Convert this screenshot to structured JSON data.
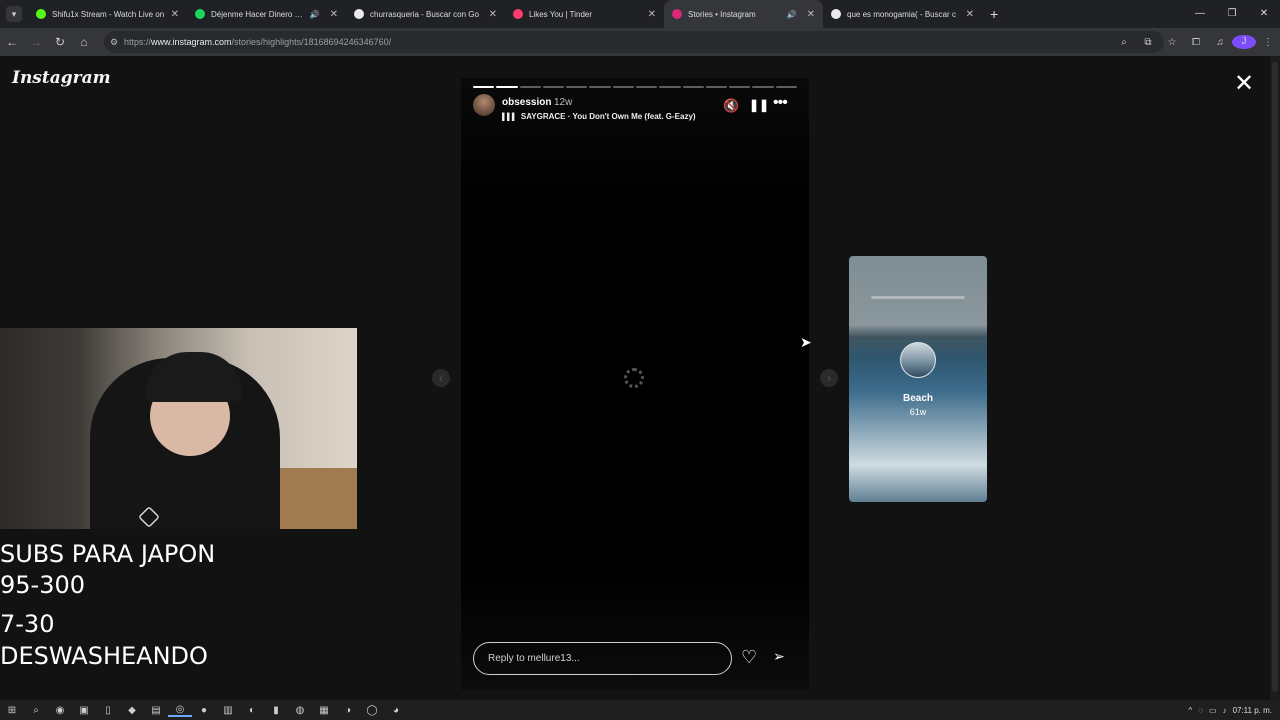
{
  "browser": {
    "tabs": [
      {
        "title": "Shifu1x Stream - Watch Live on",
        "favicon_color": "#53fc18",
        "audio": false,
        "active": false
      },
      {
        "title": "Déjenme Hacer Dinero • Ed",
        "favicon_color": "#1ed760",
        "audio": true,
        "active": false
      },
      {
        "title": "churrasqueria - Buscar con Go",
        "favicon_color": "#e8eaed",
        "audio": false,
        "active": false
      },
      {
        "title": "Likes You | Tinder",
        "favicon_color": "#fe3c72",
        "audio": false,
        "active": false
      },
      {
        "title": "Stories • Instagram",
        "favicon_color": "#d62976",
        "audio": true,
        "active": true
      },
      {
        "title": "que es monogamia( - Buscar c",
        "favicon_color": "#e8eaed",
        "audio": false,
        "active": false
      }
    ],
    "url_prefix": "https://",
    "url_host": "www.instagram.com",
    "url_path": "/stories/highlights/18168694246346760/",
    "profile_initial": "J"
  },
  "instagram": {
    "logo": "Instagram",
    "story": {
      "username": "obsession",
      "time": "12w",
      "music": "SAYGRACE · You Don't Own Me (feat. G-Eazy)",
      "segments_total": 14,
      "segments_done": 2,
      "reply_placeholder": "Reply to mellure13..."
    },
    "next_highlight": {
      "title": "Beach",
      "age": "61w"
    }
  },
  "stream_overlay": {
    "line1": "SUBS PARA JAPON",
    "line2": "95-300",
    "line3": "7-30",
    "line4": "DESWASHEANDO"
  },
  "taskbar": {
    "time": "07:11 p. m."
  }
}
